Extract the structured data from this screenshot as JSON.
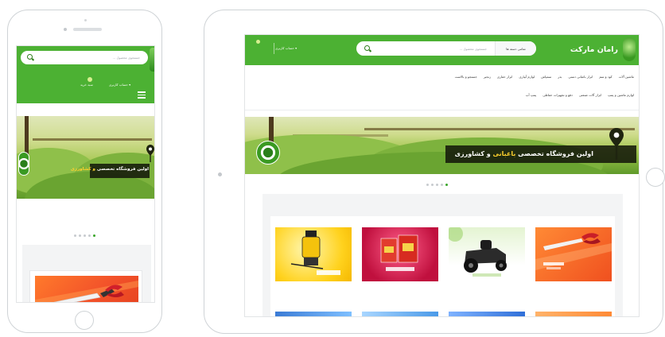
{
  "phone": {
    "search_placeholder": "جستجوی محصول ...",
    "account_label": "حساب کاربری ▾",
    "basket_label": "سبد خرید",
    "banner_text_a": "اولین فروشگاه تخصصی",
    "banner_text_b": "و کشاورزی"
  },
  "tablet": {
    "brand": "رامان مارکت",
    "search_placeholder": "جستجوی محصول ...",
    "category_select": "تمامی دسته ها",
    "account_label": "حساب کاربری ▾",
    "nav_row1": [
      "ماشین آلات",
      "کود و سم",
      "ابزار باغبانی دستی",
      "بذر",
      "سمپاش",
      "لوازم آبیاری",
      "ابزار حفاری",
      "زنجیر",
      "جستجو و بالاست"
    ],
    "nav_row2": [
      "لوازم ماشین و پمپ",
      "ابزار آلات صنعتی",
      "دفع و تجهیزات حفاظی",
      "پمپ آب"
    ],
    "banner_text_a": "اولین فروشگاه تخصصی",
    "banner_text_hl": "باغبانی",
    "banner_text_b": "و کشاورزی"
  },
  "carousel": {
    "dot_count": 5,
    "active_index": 4
  },
  "colors": {
    "brand_green": "#4cb133",
    "highlight_yellow": "#ffd22e"
  }
}
